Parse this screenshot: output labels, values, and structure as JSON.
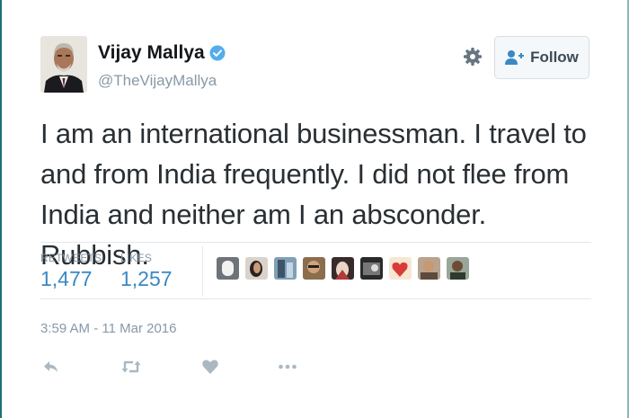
{
  "profile": {
    "name": "Vijay Mallya",
    "handle": "@TheVijayMallya",
    "verified": true
  },
  "header": {
    "settings_icon": "gear-icon",
    "follow_label": "Follow",
    "follow_icon": "add-user-icon"
  },
  "tweet": {
    "text": "I am an international businessman. I travel to and from India frequently. I did not flee from India and neither am I an absconder. Rubbish."
  },
  "stats": {
    "retweets_label": "RETWEETS",
    "retweets_value": "1,477",
    "likes_label": "LIKES",
    "likes_value": "1,257",
    "liker_avatars_count": 9
  },
  "meta": {
    "timestamp": "3:59 AM - 11 Mar 2016"
  },
  "actions": {
    "icons": [
      "reply-icon",
      "retweet-icon",
      "like-icon",
      "more-icon"
    ]
  },
  "colors": {
    "link_blue": "#3b88c3",
    "muted_gray": "#8899a6",
    "verified_blue": "#55acee",
    "text_dark": "#292f33"
  }
}
